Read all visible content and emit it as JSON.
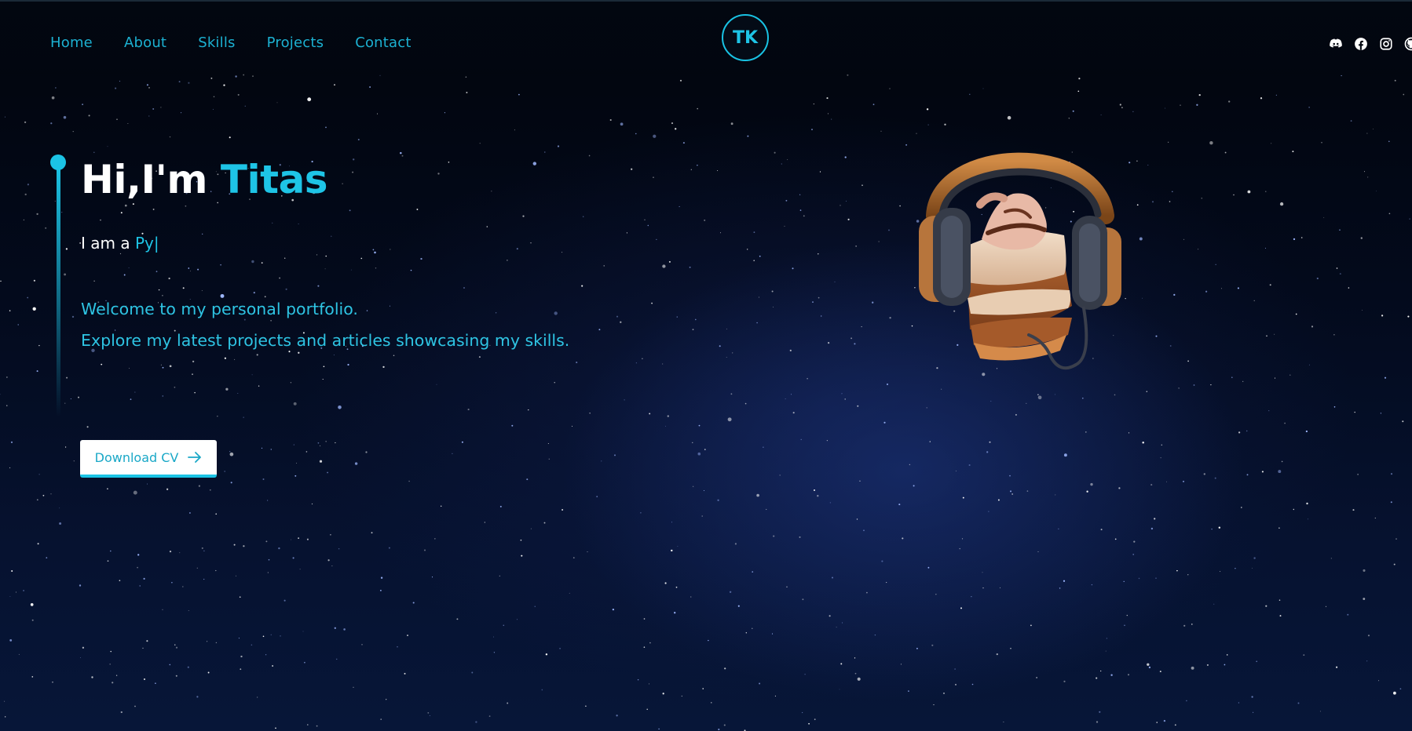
{
  "nav": {
    "links": [
      "Home",
      "About",
      "Skills",
      "Projects",
      "Contact"
    ],
    "logo_text": "TK",
    "social_icons": [
      "discord-icon",
      "facebook-icon",
      "instagram-icon",
      "github-icon"
    ]
  },
  "hero": {
    "greeting": "Hi,I'm",
    "name": "Titas",
    "typing_prefix": "I am a",
    "typing_role": "Py",
    "typing_cursor": "|",
    "welcome_line1": "Welcome to my personal portfolio.",
    "welcome_line2": "Explore my latest projects and articles showcasing my skills.",
    "cv_button_label": "Download CV",
    "cv_button_icon": "arrow-right-icon"
  },
  "colors": {
    "accent": "#1ec4e6",
    "background": "#02060f",
    "text": "#ffffff"
  }
}
